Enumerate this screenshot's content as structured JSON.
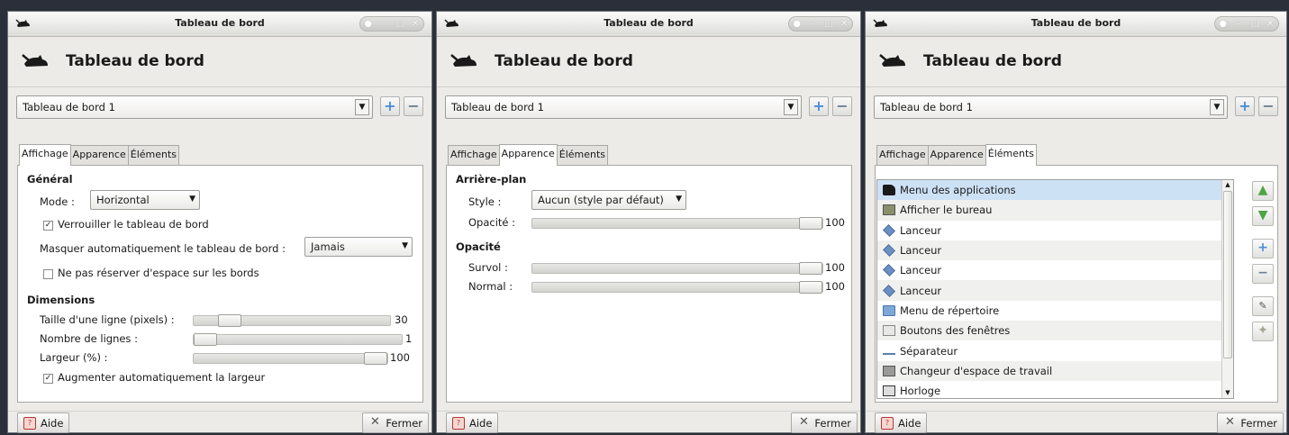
{
  "windows": [
    {
      "title": "Tableau de bord",
      "header_title": "Tableau de bord",
      "panel_select": "Tableau de bord 1",
      "tabs": [
        "Affichage",
        "Apparence",
        "Éléments"
      ],
      "active_tab": 0,
      "help_label": "Aide",
      "close_label": "Fermer"
    },
    {
      "title": "Tableau de bord",
      "header_title": "Tableau de bord",
      "panel_select": "Tableau de bord 1",
      "tabs": [
        "Affichage",
        "Apparence",
        "Éléments"
      ],
      "active_tab": 1,
      "help_label": "Aide",
      "close_label": "Fermer"
    },
    {
      "title": "Tableau de bord",
      "header_title": "Tableau de bord",
      "panel_select": "Tableau de bord 1",
      "tabs": [
        "Affichage",
        "Apparence",
        "Éléments"
      ],
      "active_tab": 2,
      "help_label": "Aide",
      "close_label": "Fermer"
    }
  ],
  "affichage": {
    "general_heading": "Général",
    "mode_label": "Mode :",
    "mode_value": "Horizontal",
    "lock_label": "Verrouiller le tableau de bord",
    "lock_checked": true,
    "autohide_label": "Masquer automatiquement le tableau de bord :",
    "autohide_value": "Jamais",
    "noreserve_label": "Ne pas réserver d'espace sur les bords",
    "noreserve_checked": false,
    "dimensions_heading": "Dimensions",
    "row_size_label": "Taille d'une ligne (pixels) :",
    "row_size_value": "30",
    "row_size_fraction": 0.14,
    "rows_label": "Nombre de lignes :",
    "rows_value": "1",
    "rows_fraction": 0.0,
    "width_label": "Largeur (%) :",
    "width_value": "100",
    "width_fraction": 1.0,
    "autogrow_label": "Augmenter automatiquement la largeur",
    "autogrow_checked": true
  },
  "apparence": {
    "background_heading": "Arrière-plan",
    "style_label": "Style :",
    "style_value": "Aucun (style par défaut)",
    "opacity_label": "Opacité :",
    "opacity_value": "100",
    "opacity_fraction": 1.0,
    "opacity_heading": "Opacité",
    "hover_label": "Survol :",
    "hover_value": "100",
    "hover_fraction": 1.0,
    "normal_label": "Normal :",
    "normal_value": "100",
    "normal_fraction": 1.0
  },
  "elements": {
    "items": [
      {
        "label": "Menu des applications",
        "icon": "mouse-icon",
        "selected": true
      },
      {
        "label": "Afficher le bureau",
        "icon": "desktop-icon",
        "selected": false
      },
      {
        "label": "Lanceur",
        "icon": "launcher-icon",
        "selected": false
      },
      {
        "label": "Lanceur",
        "icon": "launcher-icon",
        "selected": false
      },
      {
        "label": "Lanceur",
        "icon": "launcher-icon",
        "selected": false
      },
      {
        "label": "Lanceur",
        "icon": "launcher-icon",
        "selected": false
      },
      {
        "label": "Menu de répertoire",
        "icon": "folder-icon",
        "selected": false
      },
      {
        "label": "Boutons des fenêtres",
        "icon": "windows-icon",
        "selected": false
      },
      {
        "label": "Séparateur",
        "icon": "separator-icon",
        "selected": false
      },
      {
        "label": "Changeur d'espace de travail",
        "icon": "workspace-icon",
        "selected": false
      },
      {
        "label": "Horloge",
        "icon": "clock-icon",
        "selected": false
      }
    ],
    "side_buttons": [
      "move-up",
      "move-down",
      "add",
      "remove",
      "edit",
      "about"
    ]
  },
  "colors": {
    "selection": "#cde1f5",
    "add_blue": "#4d8ed6",
    "arrow_green": "#4fa443"
  }
}
